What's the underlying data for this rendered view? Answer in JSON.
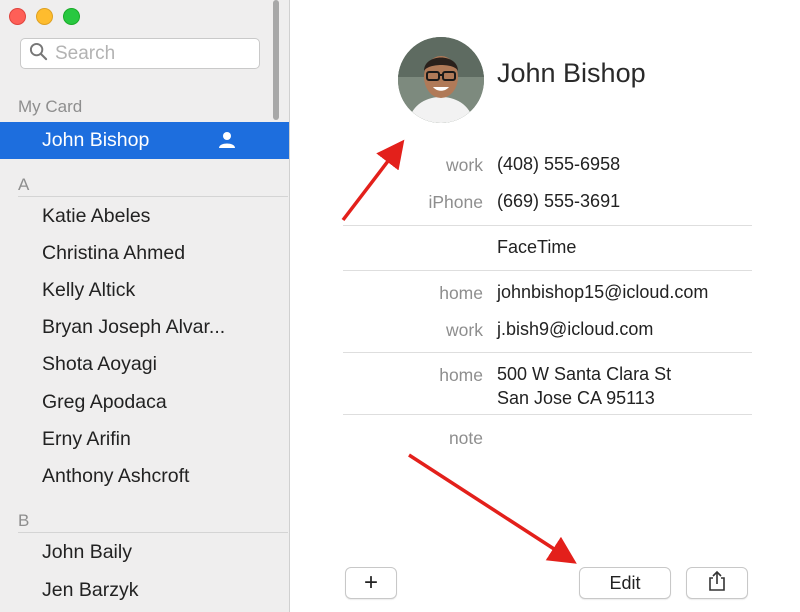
{
  "window": {
    "controls": [
      "close",
      "minimize",
      "zoom"
    ]
  },
  "search": {
    "placeholder": "Search",
    "value": "",
    "icon": "search-icon"
  },
  "sidebar": {
    "my_card_header": "My Card",
    "my_card_contact": "John Bishop",
    "groups": [
      {
        "letter": "A",
        "contacts": [
          "Katie Abeles",
          "Christina Ahmed",
          "Kelly Altick",
          "Bryan Joseph Alvar...",
          "Shota Aoyagi",
          "Greg Apodaca",
          "Erny Arifin",
          "Anthony Ashcroft"
        ]
      },
      {
        "letter": "B",
        "contacts": [
          "John Baily",
          "Jen Barzyk"
        ]
      }
    ]
  },
  "card": {
    "name": "John Bishop",
    "fields": {
      "phone_work_label": "work",
      "phone_work_value": "(408) 555-6958",
      "phone_iphone_label": "iPhone",
      "phone_iphone_value": "(669) 555-3691",
      "facetime_label": "FaceTime",
      "email_home_label": "home",
      "email_home_value": "johnbishop15@icloud.com",
      "email_work_label": "work",
      "email_work_value": "j.bish9@icloud.com",
      "address_label": "home",
      "address_line1": "500 W Santa Clara St",
      "address_line2": "San Jose CA 95113",
      "note_label": "note"
    }
  },
  "toolbar": {
    "add_label": "+",
    "edit_label": "Edit",
    "share_icon": "share-icon"
  },
  "colors": {
    "selection": "#1d6ede",
    "annotation_arrow": "#e3201b"
  }
}
